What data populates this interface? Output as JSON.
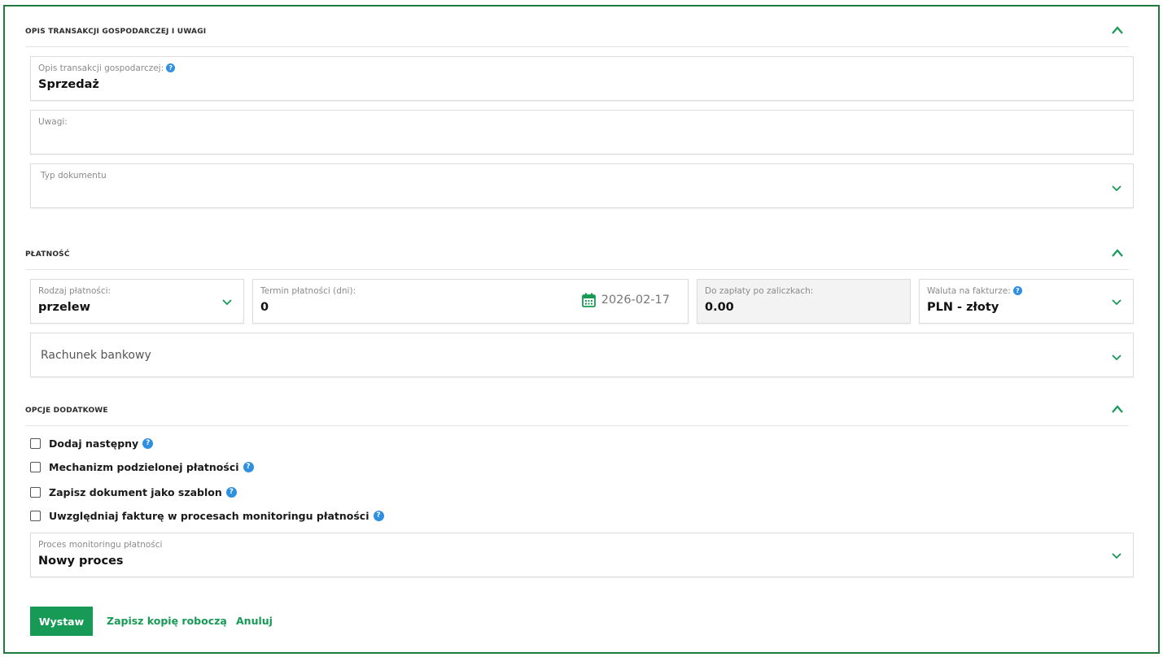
{
  "sections": {
    "opis": {
      "title": "OPIS TRANSAKCJI GOSPODARCZEJ I UWAGI",
      "fields": {
        "opis_label": "Opis transakcji gospodarczej:",
        "opis_value": "Sprzedaż",
        "uwagi_label": "Uwagi:",
        "uwagi_value": "",
        "typ_label": "Typ dokumentu",
        "typ_value": ""
      }
    },
    "platnosc": {
      "title": "PŁATNOŚĆ",
      "fields": {
        "rodzaj_label": "Rodzaj płatności:",
        "rodzaj_value": "przelew",
        "termin_label": "Termin płatności (dni):",
        "termin_value": "0",
        "termin_date": "2026-02-17",
        "do_zaplaty_label": "Do zapłaty po zaliczkach:",
        "do_zaplaty_value": "0.00",
        "waluta_label": "Waluta na fakturze:",
        "waluta_value": "PLN - złoty",
        "rachunek_placeholder": "Rachunek bankowy"
      }
    },
    "opcje": {
      "title": "OPCJE DODATKOWE",
      "checkboxes": [
        {
          "label": "Dodaj następny",
          "checked": false
        },
        {
          "label": "Mechanizm podzielonej płatności",
          "checked": false
        },
        {
          "label": "Zapisz dokument jako szablon",
          "checked": false
        },
        {
          "label": "Uwzględniaj fakturę w procesach monitoringu płatności",
          "checked": false
        }
      ],
      "proces_label": "Proces monitoringu płatności",
      "proces_value": "Nowy proces"
    }
  },
  "help_glyph": "?",
  "actions": {
    "issue_label": "Wystaw",
    "draft_label": "Zapisz kopię roboczą",
    "cancel_label": "Anuluj"
  },
  "colors": {
    "accent": "#169a55",
    "frame": "#1f7a3d",
    "help": "#2f8fe0"
  }
}
